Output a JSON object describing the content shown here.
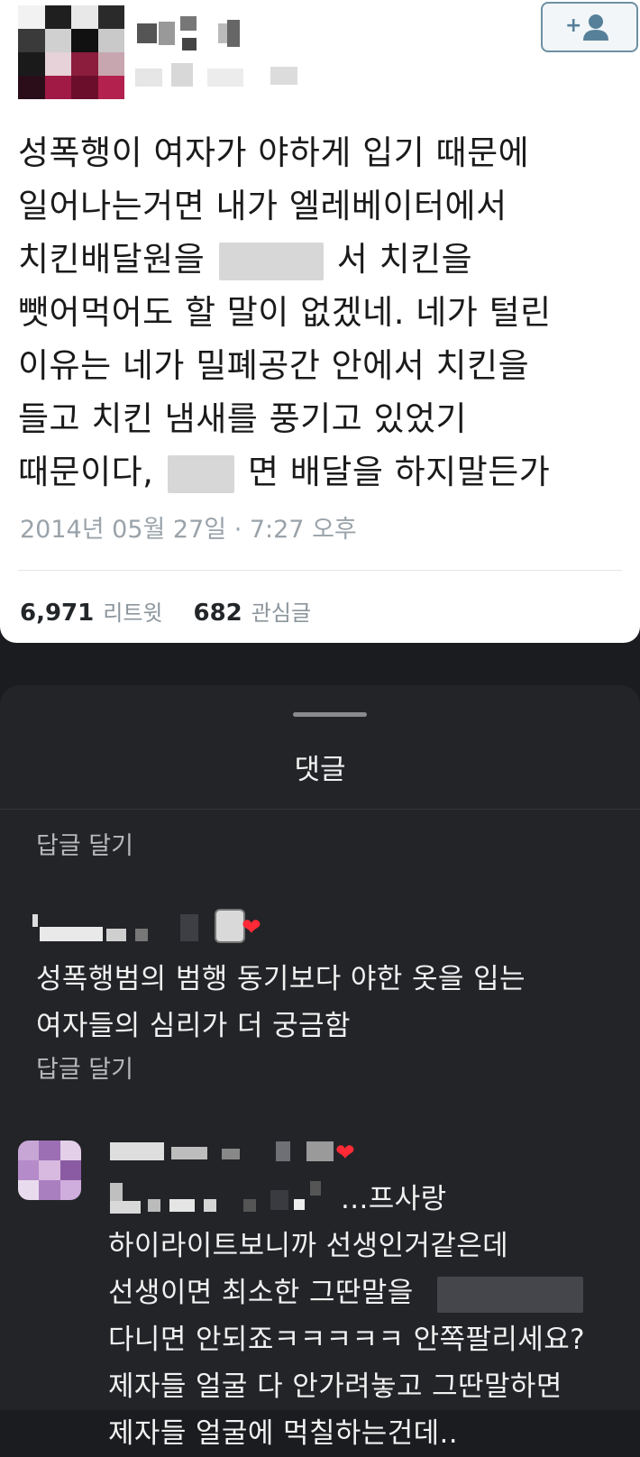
{
  "tweet": {
    "lines": [
      "성폭행이 여자가 야하게 입기 때문에",
      "일어나는거면 내가 엘레베이터에서",
      "치킨배달원을",
      "서 치킨을",
      "뺏어먹어도 할 말이 없겠네. 네가 털린",
      "이유는 네가 밀폐공간 안에서 치킨을",
      "들고 치킨 냄새를 풍기고 있었기",
      "때문이다,",
      "면 배달을 하지말든가"
    ],
    "date": "2014년 05월 27일 · 7:27 오후",
    "retweet_count": "6,971",
    "retweet_label": "리트윗",
    "like_count": "682",
    "like_label": "관심글"
  },
  "comments_sheet": {
    "title": "댓글",
    "reply_label": "답글 달기",
    "comment1": {
      "lines": [
        "성폭행범의 범행 동기보다 야한 옷을 입는",
        "여자들의 심리가 더 궁금함"
      ],
      "heart": "❤"
    },
    "comment2": {
      "lines": [
        "...프사랑",
        "하이라이트보니까 선생인거같은데",
        "선생이면 최소한 그딴말을",
        "다니면 안되죠ㅋㅋㅋㅋㅋ 안쪽팔리세요?",
        "제자들 얼굴 다 안가려놓고 그딴말하면",
        "제자들 얼굴에 먹칠하는건데.."
      ],
      "heart": "❤"
    }
  },
  "colors": {
    "heart": "#ff2a35",
    "sheet_bg": "#232428",
    "card_bg": "#ffffff"
  },
  "icons": {
    "follow": "add-user-icon"
  }
}
